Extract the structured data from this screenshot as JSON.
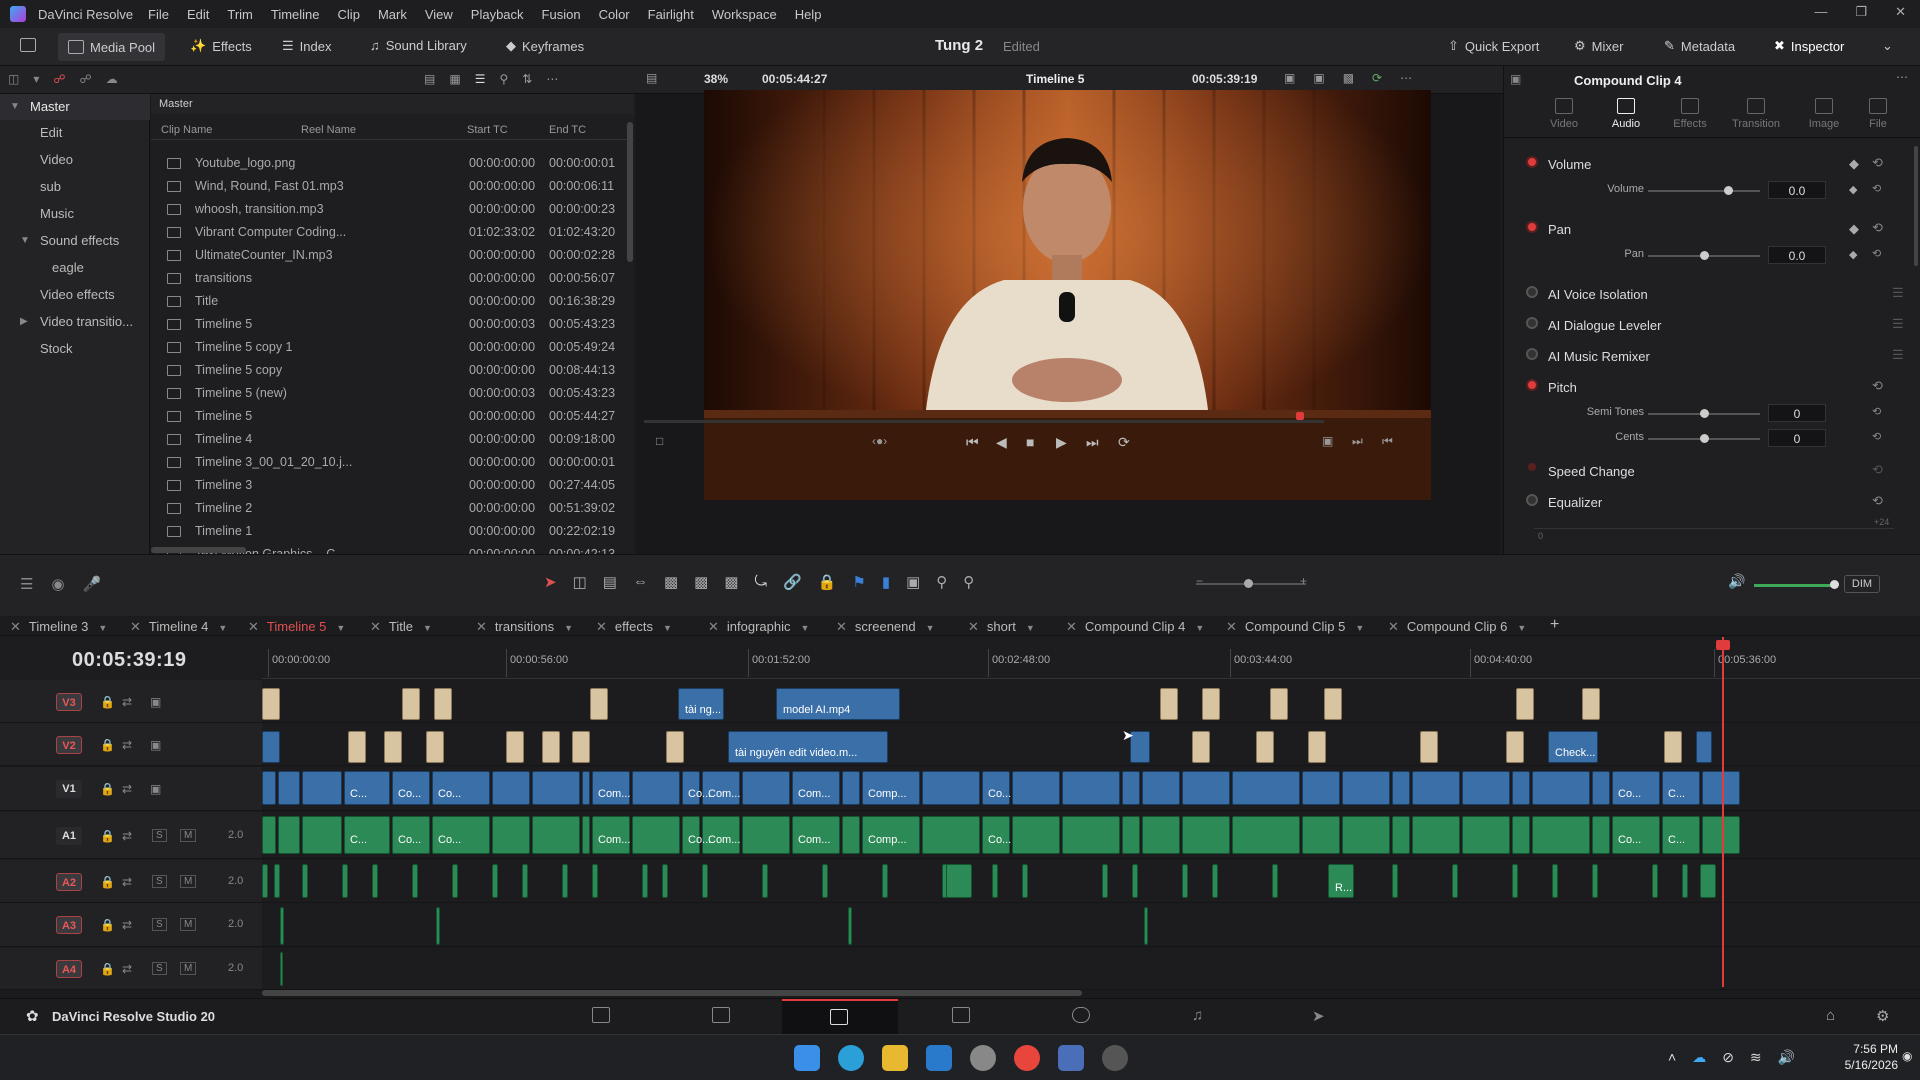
{
  "app": {
    "name": "DaVinci Resolve",
    "status_name": "DaVinci Resolve Studio 20"
  },
  "menu": [
    "File",
    "Edit",
    "Trim",
    "Timeline",
    "Clip",
    "Mark",
    "View",
    "Playback",
    "Fusion",
    "Color",
    "Fairlight",
    "Workspace",
    "Help"
  ],
  "toolbar": {
    "media_pool": "Media Pool",
    "effects": "Effects",
    "index": "Index",
    "sound_library": "Sound Library",
    "keyframes": "Keyframes",
    "project": "Tung 2",
    "edited": "Edited",
    "quick_export": "Quick Export",
    "mixer": "Mixer",
    "metadata": "Metadata",
    "inspector": "Inspector"
  },
  "viewer_bar": {
    "zoom": "38%",
    "source_tc": "00:05:44:27",
    "timeline_name": "Timeline 5",
    "record_tc": "00:05:39:19"
  },
  "bins": {
    "master": "Master",
    "items": [
      {
        "label": "Edit",
        "level": 1
      },
      {
        "label": "Video",
        "level": 1
      },
      {
        "label": "sub",
        "level": 1
      },
      {
        "label": "Music",
        "level": 1
      },
      {
        "label": "Sound effects",
        "level": 1,
        "expanded": true
      },
      {
        "label": "eagle",
        "level": 2
      },
      {
        "label": "Video effects",
        "level": 1
      },
      {
        "label": "Video transitio...",
        "level": 1,
        "collapsed": true
      },
      {
        "label": "Stock",
        "level": 1
      }
    ]
  },
  "media_pool": {
    "header": "Master",
    "columns": [
      "Clip Name",
      "Reel Name",
      "Start TC",
      "End TC"
    ],
    "clips": [
      {
        "name": "Youtube_logo.png",
        "start": "00:00:00:00",
        "end": "00:00:00:01"
      },
      {
        "name": "Wind, Round, Fast 01.mp3",
        "start": "00:00:00:00",
        "end": "00:00:06:11"
      },
      {
        "name": "whoosh, transition.mp3",
        "start": "00:00:00:00",
        "end": "00:00:00:23"
      },
      {
        "name": "Vibrant Computer Coding...",
        "start": "01:02:33:02",
        "end": "01:02:43:20"
      },
      {
        "name": "UltimateCounter_IN.mp3",
        "start": "00:00:00:00",
        "end": "00:00:02:28"
      },
      {
        "name": "transitions",
        "start": "00:00:00:00",
        "end": "00:00:56:07"
      },
      {
        "name": "Title",
        "start": "00:00:00:00",
        "end": "00:16:38:29"
      },
      {
        "name": "Timeline 5",
        "start": "00:00:00:03",
        "end": "00:05:43:23"
      },
      {
        "name": "Timeline 5 copy 1",
        "start": "00:00:00:00",
        "end": "00:05:49:24"
      },
      {
        "name": "Timeline 5 copy",
        "start": "00:00:00:00",
        "end": "00:08:44:13"
      },
      {
        "name": "Timeline 5 (new)",
        "start": "00:00:00:03",
        "end": "00:05:43:23"
      },
      {
        "name": "Timeline 5",
        "start": "00:00:00:00",
        "end": "00:05:44:27"
      },
      {
        "name": "Timeline 4",
        "start": "00:00:00:00",
        "end": "00:09:18:00"
      },
      {
        "name": "Timeline 3_00_01_20_10.j...",
        "start": "00:00:00:00",
        "end": "00:00:00:01"
      },
      {
        "name": "Timeline 3",
        "start": "00:00:00:00",
        "end": "00:27:44:05"
      },
      {
        "name": "Timeline 2",
        "start": "00:00:00:00",
        "end": "00:51:39:02"
      },
      {
        "name": "Timeline 1",
        "start": "00:00:00:00",
        "end": "00:22:02:19"
      },
      {
        "name": "Text Motion Graphics – C...",
        "start": "00:00:00:00",
        "end": "00:00:42:13"
      }
    ]
  },
  "inspector": {
    "title": "Compound Clip 4",
    "tabs": [
      "Video",
      "Audio",
      "Effects",
      "Transition",
      "Image",
      "File"
    ],
    "active_tab": "Audio",
    "sections": {
      "volume": {
        "label": "Volume",
        "param": "Volume",
        "value": "0.0"
      },
      "pan": {
        "label": "Pan",
        "param": "Pan",
        "value": "0.0"
      },
      "voice_isolation": "AI Voice Isolation",
      "dialogue_leveler": "AI Dialogue Leveler",
      "music_remixer": "AI Music Remixer",
      "pitch": {
        "label": "Pitch",
        "semi_tones_label": "Semi Tones",
        "semi_tones": "0",
        "cents_label": "Cents",
        "cents": "0"
      },
      "speed_change": "Speed Change",
      "equalizer": "Equalizer",
      "eq_scale_low": "0",
      "eq_scale_high": "+24"
    }
  },
  "timeline_tabs": [
    {
      "label": "Timeline 3"
    },
    {
      "label": "Timeline 4"
    },
    {
      "label": "Timeline 5",
      "active": true
    },
    {
      "label": "Title"
    },
    {
      "label": "transitions"
    },
    {
      "label": "effects"
    },
    {
      "label": "infographic"
    },
    {
      "label": "screenend"
    },
    {
      "label": "short"
    },
    {
      "label": "Compound Clip 4"
    },
    {
      "label": "Compound Clip 5"
    },
    {
      "label": "Compound Clip 6"
    }
  ],
  "timeline": {
    "timecode": "00:05:39:19",
    "ruler": [
      "00:00:00:00",
      "00:00:56:00",
      "00:01:52:00",
      "00:02:48:00",
      "00:03:44:00",
      "00:04:40:00",
      "00:05:36:00"
    ],
    "dim_label": "DIM",
    "tracks": [
      {
        "name": "V3",
        "type": "video"
      },
      {
        "name": "V2",
        "type": "video"
      },
      {
        "name": "V1",
        "type": "video"
      },
      {
        "name": "A1",
        "type": "audio",
        "level": "2.0"
      },
      {
        "name": "A2",
        "type": "audio",
        "level": "2.0"
      },
      {
        "name": "A3",
        "type": "audio",
        "level": "2.0"
      },
      {
        "name": "A4",
        "type": "audio",
        "level": "2.0"
      }
    ],
    "clip_labels": {
      "v3_a": "tài ng...",
      "v3_b": "model AI.mp4",
      "v2_a": "tài nguyên edit video.m...",
      "v2_b": "Check...",
      "v1": [
        "C...",
        "Co...",
        "Co...",
        "Com...",
        "Co...",
        "Com...",
        "Com...",
        "Comp...",
        "Co...",
        "Co...",
        "C..."
      ],
      "a2": "R..."
    }
  },
  "taskbar": {
    "time": "7:56 PM",
    "date": "5/16/2026"
  }
}
